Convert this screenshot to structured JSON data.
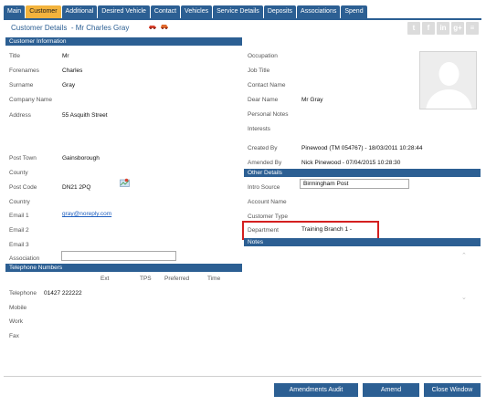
{
  "tabs": [
    {
      "label": "Main"
    },
    {
      "label": "Customer"
    },
    {
      "label": "Additional"
    },
    {
      "label": "Desired Vehicle"
    },
    {
      "label": "Contact"
    },
    {
      "label": "Vehicles"
    },
    {
      "label": "Service Details"
    },
    {
      "label": "Deposits"
    },
    {
      "label": "Associations"
    },
    {
      "label": "Spend"
    }
  ],
  "active_tab": "Customer",
  "header": {
    "title": "Customer Details",
    "customer_name": "- Mr Charles Gray"
  },
  "social": [
    "twitter",
    "facebook",
    "linkedin",
    "google-plus",
    "more"
  ],
  "customer_info": {
    "heading": "Customer Information",
    "title_label": "Title",
    "title_value": "Mr",
    "forenames_label": "Forenames",
    "forenames_value": "Charles",
    "surname_label": "Surname",
    "surname_value": "Gray",
    "company_label": "Company Name",
    "address_label": "Address",
    "address_value": "55 Asquith Street",
    "posttown_label": "Post Town",
    "posttown_value": "Gainsborough",
    "county_label": "County",
    "postcode_label": "Post Code",
    "postcode_value": "DN21 2PQ",
    "country_label": "Country",
    "email1_label": "Email 1",
    "email1_value": "gray@noreply.com",
    "email2_label": "Email 2",
    "email3_label": "Email 3",
    "association_label": "Association"
  },
  "right_info": {
    "occupation_label": "Occupation",
    "jobtitle_label": "Job Title",
    "contactname_label": "Contact Name",
    "dearname_label": "Dear Name",
    "dearname_value": "Mr Gray",
    "personalnotes_label": "Personal Notes",
    "interests_label": "Interests",
    "createdby_label": "Created By",
    "createdby_value": "Pinewood (TM 054767) - 18/03/2011 10:28:44",
    "amendedby_label": "Amended By",
    "amendedby_value": "Nick Pinewood - 07/04/2015 10:28:30"
  },
  "other_details": {
    "heading": "Other Details",
    "introsource_label": "Intro Source",
    "introsource_value": "Birmingham Post",
    "accountname_label": "Account Name",
    "customertype_label": "Customer Type",
    "department_label": "Department",
    "department_value": "Training Branch 1 -"
  },
  "notes": {
    "heading": "Notes"
  },
  "telephone": {
    "heading": "Telephone Numbers",
    "col_ext": "Ext",
    "col_tps": "TPS",
    "col_preferred": "Preferred",
    "col_time": "Time",
    "telephone_label": "Telephone",
    "telephone_value": "01427 222222",
    "mobile_label": "Mobile",
    "work_label": "Work",
    "fax_label": "Fax"
  },
  "buttons": {
    "amendments_audit": "Amendments Audit",
    "amend": "Amend",
    "close_window": "Close Window"
  },
  "colors": {
    "tab_blue": "#2c5f93",
    "tab_active": "#f3b33d",
    "highlight": "#d41f1f",
    "link": "#1f5fbf"
  }
}
